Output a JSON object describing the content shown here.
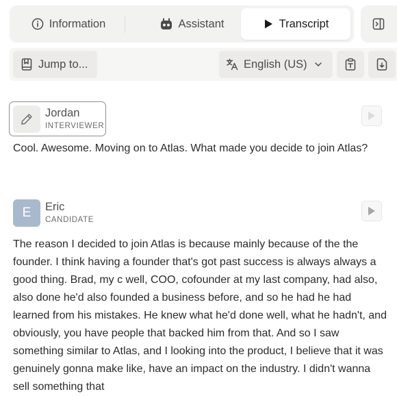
{
  "tabs": {
    "information": "Information",
    "assistant": "Assistant",
    "transcript": "Transcript",
    "active": "Transcript"
  },
  "toolbar": {
    "jump_label": "Jump to...",
    "language_label": "English (US)"
  },
  "transcript": [
    {
      "speaker": "Jordan",
      "role": "INTERVIEWER",
      "text": "Cool. Awesome. Moving on to Atlas. What made you decide to join Atlas?"
    },
    {
      "speaker": "Eric",
      "initial": "E",
      "role": "CANDIDATE",
      "text": "The reason I decided to join Atlas is because mainly because of the the founder. I think having a founder that's got past success is always always a good thing. Brad, my c well, COO, cofounder at my last company, had also, also done he'd also founded a business before, and so he had he had learned from his mistakes. He knew what he'd done well, what he hadn't, and obviously, you have people that backed him from that. And so I saw something similar to Atlas, and I looking into the product, I believe that it was genuinely gonna make like, have an impact on the industry. I didn't wanna sell something that"
    }
  ],
  "colors": {
    "tab_bg": "#f2f2f1",
    "active_tab_bg": "#ffffff",
    "avatar_e": "#a8b9cd",
    "speaker_border": "#8e8e8e"
  },
  "icons": {
    "information": "info-circle-icon",
    "assistant": "robot-icon",
    "transcript": "play-icon",
    "collapse": "panel-collapse-icon",
    "jump": "bookmark-icon",
    "language": "translate-icon",
    "language_dropdown": "chevron-down-icon",
    "copy": "clipboard-icon",
    "download": "download-icon",
    "edit": "pencil-icon",
    "play_utterance": "play-icon"
  }
}
